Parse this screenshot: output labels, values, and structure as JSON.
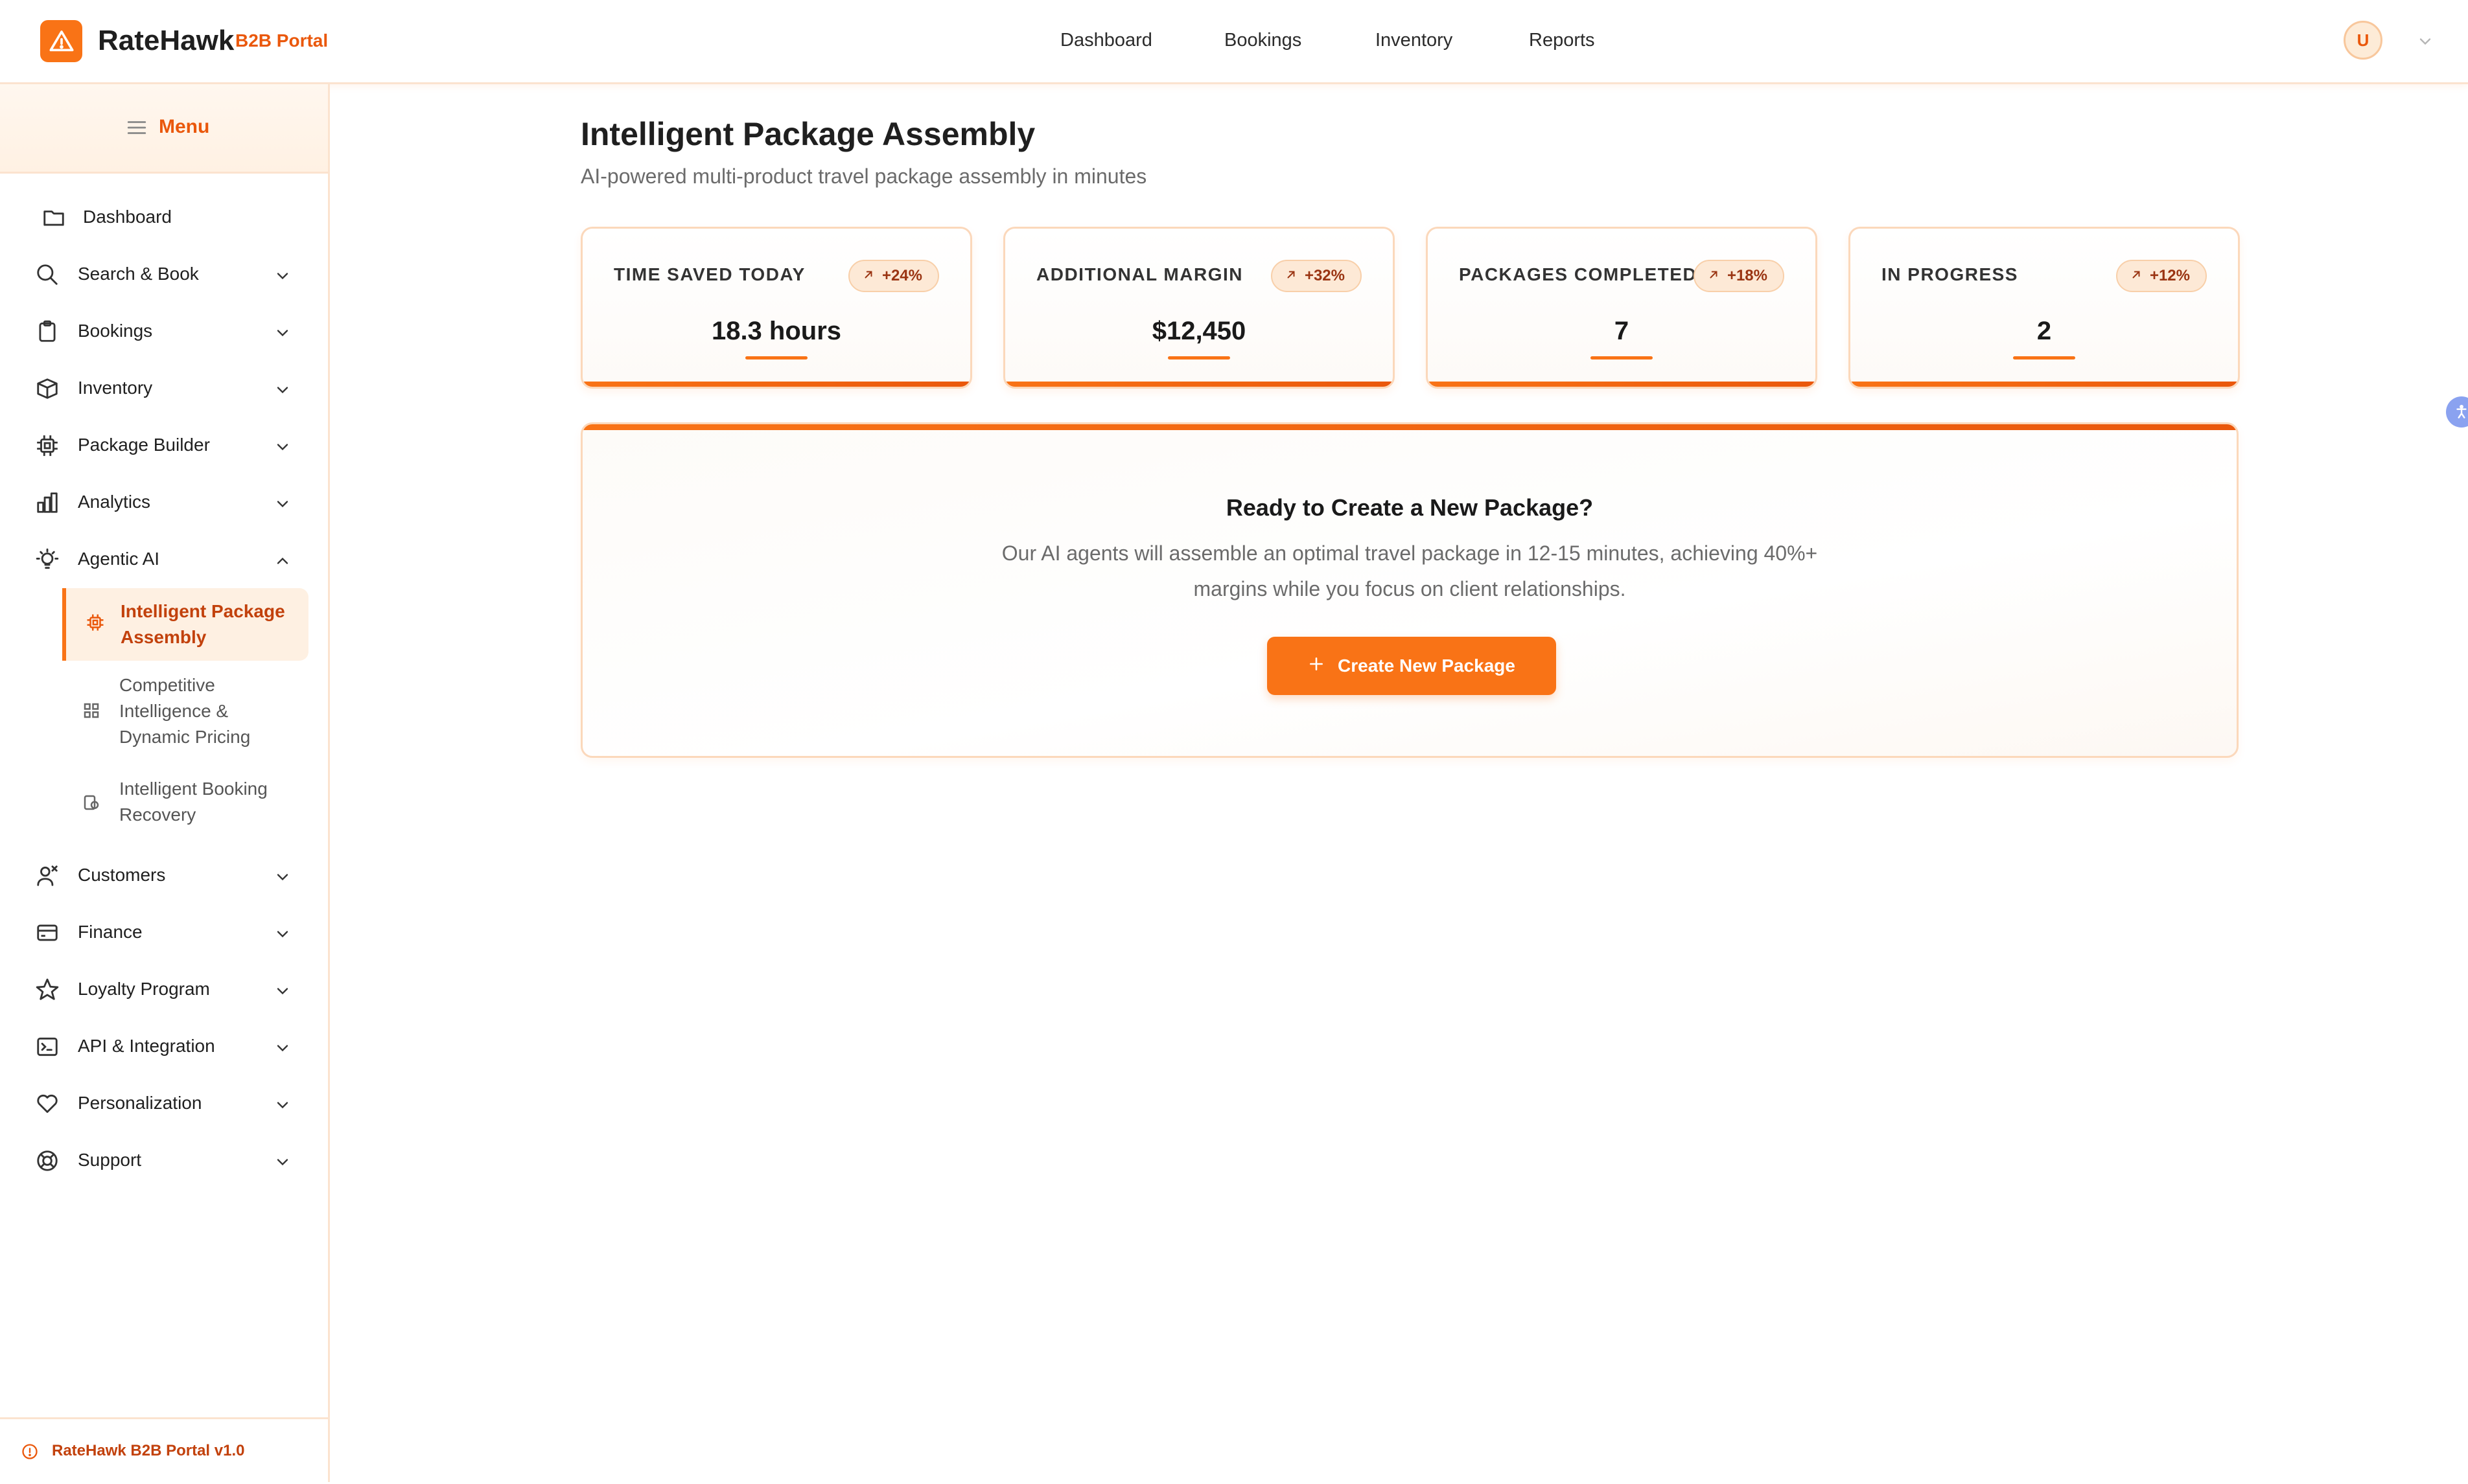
{
  "brand": {
    "name": "RateHawk",
    "sub": "B2B Portal"
  },
  "top_nav": [
    "Dashboard",
    "Bookings",
    "Inventory",
    "Reports"
  ],
  "user": {
    "avatar_initial": "U"
  },
  "sidebar": {
    "menu_label": "Menu",
    "items": [
      {
        "label": "Dashboard",
        "icon": "folder-icon"
      },
      {
        "label": "Search & Book",
        "icon": "search-icon"
      },
      {
        "label": "Bookings",
        "icon": "clipboard-icon"
      },
      {
        "label": "Inventory",
        "icon": "box-icon"
      },
      {
        "label": "Package Builder",
        "icon": "cpu-icon"
      },
      {
        "label": "Analytics",
        "icon": "bar-chart-icon"
      },
      {
        "label": "Agentic AI",
        "icon": "lightbulb-icon"
      },
      {
        "label": "Customers",
        "icon": "users-icon"
      },
      {
        "label": "Finance",
        "icon": "credit-card-icon"
      },
      {
        "label": "Loyalty Program",
        "icon": "star-icon"
      },
      {
        "label": "API & Integration",
        "icon": "terminal-icon"
      },
      {
        "label": "Personalization",
        "icon": "heart-icon"
      },
      {
        "label": "Support",
        "icon": "life-buoy-icon"
      }
    ],
    "agentic_sub": [
      {
        "label": "Intelligent Package Assembly",
        "icon": "cpu-icon"
      },
      {
        "label": "Competitive Intelligence & Dynamic Pricing",
        "icon": "grid-icon"
      },
      {
        "label": "Intelligent Booking Recovery",
        "icon": "recovery-icon"
      }
    ],
    "footer": "RateHawk B2B Portal v1.0"
  },
  "page": {
    "title": "Intelligent Package Assembly",
    "subtitle": "AI-powered multi-product travel package assembly in minutes"
  },
  "stats": [
    {
      "label": "TIME SAVED TODAY",
      "trend": "+24%",
      "value": "18.3 hours"
    },
    {
      "label": "ADDITIONAL MARGIN",
      "trend": "+32%",
      "value": "$12,450"
    },
    {
      "label": "PACKAGES COMPLETED",
      "trend": "+18%",
      "value": "7"
    },
    {
      "label": "IN PROGRESS",
      "trend": "+12%",
      "value": "2"
    }
  ],
  "cta": {
    "title": "Ready to Create a New Package?",
    "description": "Our AI agents will assemble an optimal travel package in 12-15 minutes, achieving 40%+ margins while you focus on client relationships.",
    "button_label": "Create New Package"
  },
  "colors": {
    "accent": "#f97316",
    "accent_dark": "#ea580c",
    "border": "#fbd8bb"
  }
}
